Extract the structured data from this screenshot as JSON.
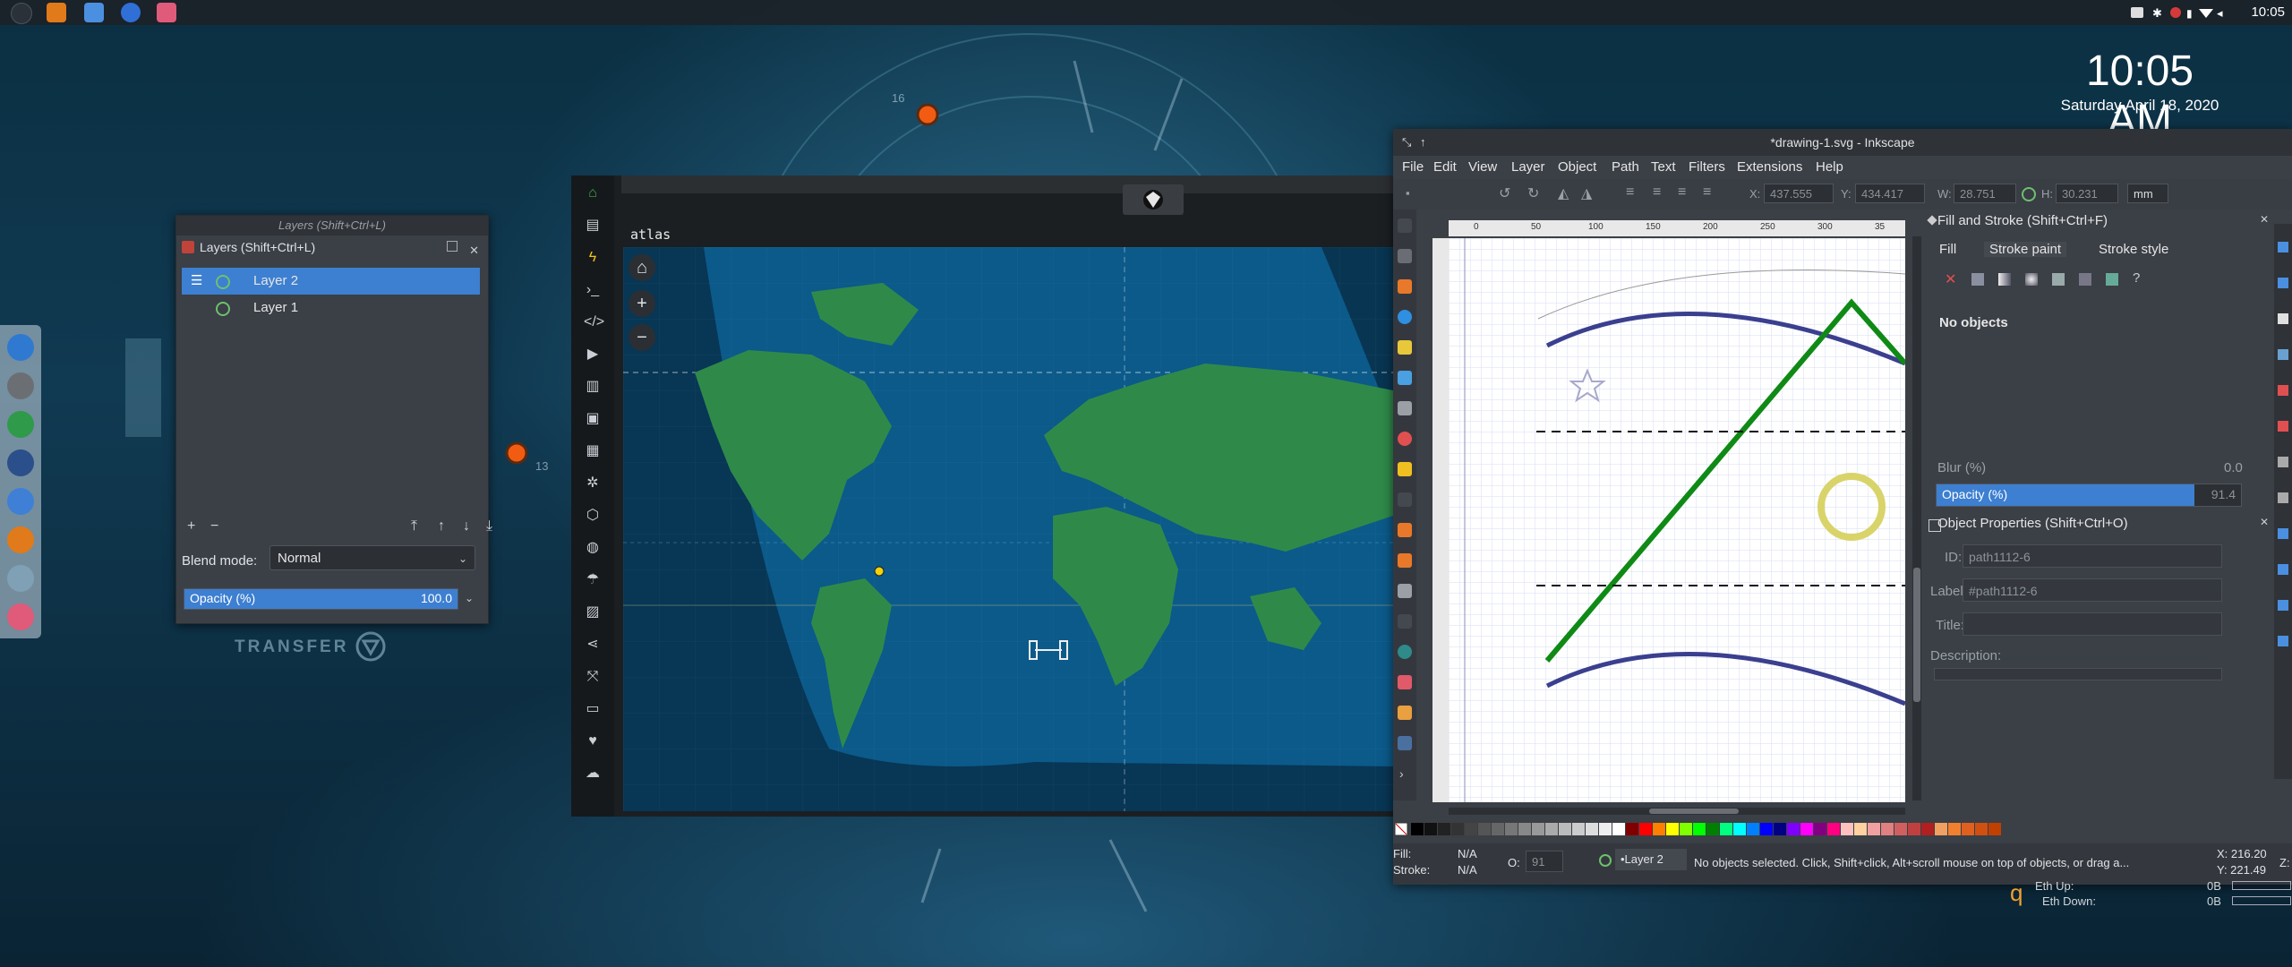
{
  "top_panel": {
    "time": "10:05"
  },
  "desktop_clock": {
    "time": "10:05 AM",
    "date": "Saturday April 18, 2020"
  },
  "wallpaper": {
    "transfer_label": "TRANSFER",
    "marker_label_1": "16",
    "marker_label_2": "13"
  },
  "layers_dialog": {
    "window_title": "Layers (Shift+Ctrl+L)",
    "tab_title": "Layers (Shift+Ctrl+L)",
    "layers": [
      {
        "name": "Layer 2",
        "selected": true
      },
      {
        "name": "Layer 1",
        "selected": false
      }
    ],
    "blend_label": "Blend mode:",
    "blend_value": "Normal",
    "opacity_label": "Opacity (%)",
    "opacity_value": "100.0",
    "opacity_fraction": 1.0
  },
  "atlas": {
    "title": "atlas"
  },
  "inkscape": {
    "title": "*drawing-1.svg - Inkscape",
    "menu": [
      "File",
      "Edit",
      "View",
      "Layer",
      "Object",
      "Path",
      "Text",
      "Filters",
      "Extensions",
      "Help"
    ],
    "toolbar": {
      "x_label": "X:",
      "x_value": "437.555",
      "y_label": "Y:",
      "y_value": "434.417",
      "w_label": "W:",
      "w_value": "28.751",
      "h_label": "H:",
      "h_value": "30.231",
      "unit": "mm"
    },
    "ruler_ticks": [
      "0",
      "50",
      "100",
      "150",
      "200",
      "250",
      "300",
      "35"
    ],
    "fill_stroke": {
      "title": "Fill and Stroke (Shift+Ctrl+F)",
      "tabs": [
        "Fill",
        "Stroke paint",
        "Stroke style"
      ],
      "no_objects": "No objects",
      "blur_label": "Blur (%)",
      "blur_value": "0.0",
      "opacity_label": "Opacity (%)",
      "opacity_value": "91.4"
    },
    "object_properties": {
      "title": "Object Properties (Shift+Ctrl+O)",
      "id_label": "ID:",
      "id_value": "path1112-6",
      "label_label": "Label:",
      "label_value": "#path1112-6",
      "title_label": "Title:",
      "description_label": "Description:"
    },
    "status": {
      "fill_label": "Fill:",
      "fill_value": "N/A",
      "stroke_label": "Stroke:",
      "stroke_value": "N/A",
      "o_label": "O:",
      "o_value": "91",
      "layer": "•Layer 2",
      "message": "No objects selected. Click, Shift+click, Alt+scroll mouse on top of objects, or drag a...",
      "x_readout": "X: 216.20",
      "y_readout": "Y: 221.49",
      "z_label": "Z:"
    },
    "colors": {
      "accent": "#3d7fd1",
      "green_line": "#0f8a15",
      "blue_curve": "#3b3f8f",
      "ring": "#d8d46a"
    }
  },
  "conky": {
    "up_label": "Eth Up:",
    "up_value": "0B",
    "down_label": "Eth Down:",
    "down_value": "0B",
    "glyph": "q"
  }
}
